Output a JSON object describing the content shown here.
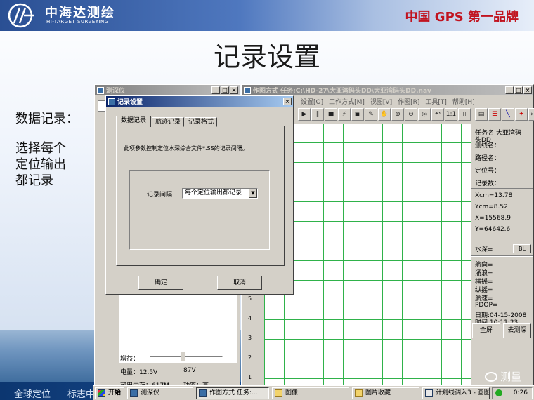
{
  "slide": {
    "logo_cn": "中海达测绘",
    "logo_en": "HI-TARGET SURVEYING",
    "slogan": "中国 GPS 第一品牌",
    "title": "记录设置",
    "left_heading": "数据记录：",
    "left_lines": [
      "选择每个",
      "定位输出",
      "都记录"
    ],
    "band_items": [
      "全球定位",
      "标志中"
    ],
    "watermark": "测量"
  },
  "depth_window": {
    "title": "测深仪",
    "gain_label": "增益：",
    "gain_level": 0.45,
    "voltage_label": "电量：12.5V",
    "voltage_value": "87V",
    "memory_label": "可用内存：617M",
    "power_label": "功率：高"
  },
  "plot_window": {
    "title": "作图方式 任务:C:\\HD-27\\大亚湾码头DD\\大亚湾码头DD.nav",
    "menus": [
      "设置[O]",
      "工作方式[M]",
      "视图[V]",
      "作图[R]",
      "工具[T]",
      "帮助[H]"
    ],
    "toolbar_icons": [
      "play",
      "pause",
      "stop",
      "record",
      "lock",
      "pen",
      "hand",
      "zoom-in",
      "zoom-out",
      "zoom-all",
      "zoom-prev",
      "one-to-one",
      "page"
    ],
    "right_toolbar_icons": [
      "table",
      "list",
      "line",
      "target",
      "more"
    ],
    "y_axis_labels": [
      "5",
      "4",
      "3",
      "2",
      "1"
    ],
    "info": {
      "task": "任务名:大亚湾码",
      "task_sub": "头DD",
      "survey_line": "测线名：",
      "route": "路径名：",
      "point": "定位号：",
      "record_count": "记录数：",
      "xcm": "Xcm=13.78",
      "ycm": "Ycm=8.52",
      "x": "X=15568.9",
      "y": "Y=64642.6",
      "depth": "水深=",
      "bl": "BL",
      "heading": "航向=",
      "rolling": "涌浪=",
      "cross": "横摇=",
      "pitch": "纵摇=",
      "speed": "航速=",
      "pdop": "PDOP=",
      "date": "日期:04-15-2008",
      "time": "时间 10:11:23"
    },
    "fullscreen_button": "全屏",
    "go_depth_button": "去测深"
  },
  "dialog": {
    "title": "记录设置",
    "tabs": [
      "数据记录",
      "航迹记录",
      "记录格式"
    ],
    "description": "此项参数控制定位水深综合文件*.SS的记录间隔。",
    "interval_label": "记录间隔",
    "interval_value": "每个定位输出都记录",
    "ok_button": "确定",
    "cancel_button": "取消"
  },
  "taskbar": {
    "start": "开始",
    "tasks": [
      {
        "label": "测深仪",
        "icon": "app"
      },
      {
        "label": "作图方式  任务:...",
        "icon": "app"
      },
      {
        "label": "图像",
        "icon": "folder"
      },
      {
        "label": "图片收藏",
        "icon": "folder"
      },
      {
        "label": "计划线调入3 - 画图",
        "icon": "paint"
      }
    ],
    "clock": "0:26"
  }
}
